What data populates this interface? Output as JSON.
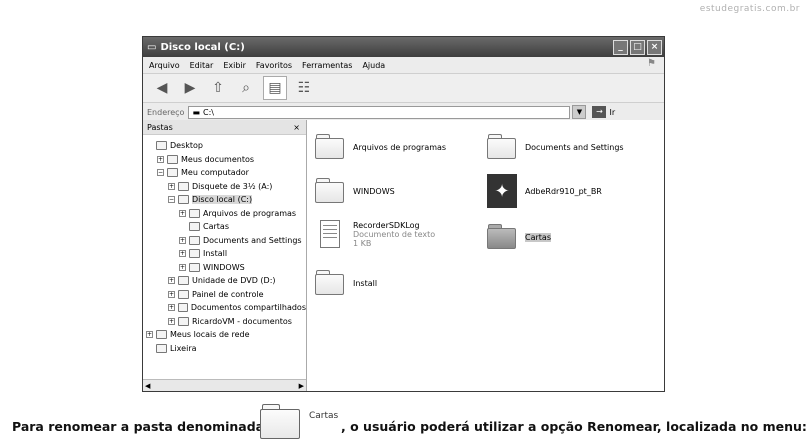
{
  "watermark": "estudegratis.com.br",
  "window": {
    "title": "Disco local (C:)",
    "menu": [
      "Arquivo",
      "Editar",
      "Exibir",
      "Favoritos",
      "Ferramentas",
      "Ajuda"
    ],
    "address_label": "Endereço",
    "address_value": "C:\\",
    "go_label": "Ir"
  },
  "folders_pane": {
    "header": "Pastas",
    "close": "×",
    "tree": [
      {
        "label": "Desktop",
        "indent": 0,
        "expander": ""
      },
      {
        "label": "Meus documentos",
        "indent": 1,
        "expander": "+"
      },
      {
        "label": "Meu computador",
        "indent": 1,
        "expander": "−"
      },
      {
        "label": "Disquete de 3½ (A:)",
        "indent": 2,
        "expander": "+"
      },
      {
        "label": "Disco local (C:)",
        "indent": 2,
        "expander": "−",
        "selected": true
      },
      {
        "label": "Arquivos de programas",
        "indent": 3,
        "expander": "+"
      },
      {
        "label": "Cartas",
        "indent": 3,
        "expander": ""
      },
      {
        "label": "Documents and Settings",
        "indent": 3,
        "expander": "+"
      },
      {
        "label": "Install",
        "indent": 3,
        "expander": "+"
      },
      {
        "label": "WINDOWS",
        "indent": 3,
        "expander": "+"
      },
      {
        "label": "Unidade de DVD (D:)",
        "indent": 2,
        "expander": "+"
      },
      {
        "label": "Painel de controle",
        "indent": 2,
        "expander": "+"
      },
      {
        "label": "Documentos compartilhados",
        "indent": 2,
        "expander": "+"
      },
      {
        "label": "RicardoVM - documentos",
        "indent": 2,
        "expander": "+"
      },
      {
        "label": "Meus locais de rede",
        "indent": 0,
        "expander": "+"
      },
      {
        "label": "Lixeira",
        "indent": 0,
        "expander": ""
      }
    ]
  },
  "content": {
    "items": [
      {
        "name": "Arquivos de programas",
        "type": "folder"
      },
      {
        "name": "Documents and Settings",
        "type": "folder"
      },
      {
        "name": "WINDOWS",
        "type": "folder"
      },
      {
        "name": "AdbeRdr910_pt_BR",
        "type": "pdf-installer"
      },
      {
        "name": "RecorderSDKLog",
        "type": "text",
        "detail1": "Documento de texto",
        "detail2": "1 KB"
      },
      {
        "name": "Cartas",
        "type": "folder-selected"
      },
      {
        "name": "Install",
        "type": "folder"
      }
    ]
  },
  "question": {
    "part1": "Para renomear a pasta denominada",
    "folder_label": "Cartas",
    "part2": ", o usuário poderá utilizar a opção Renomear, localizada no menu:"
  }
}
